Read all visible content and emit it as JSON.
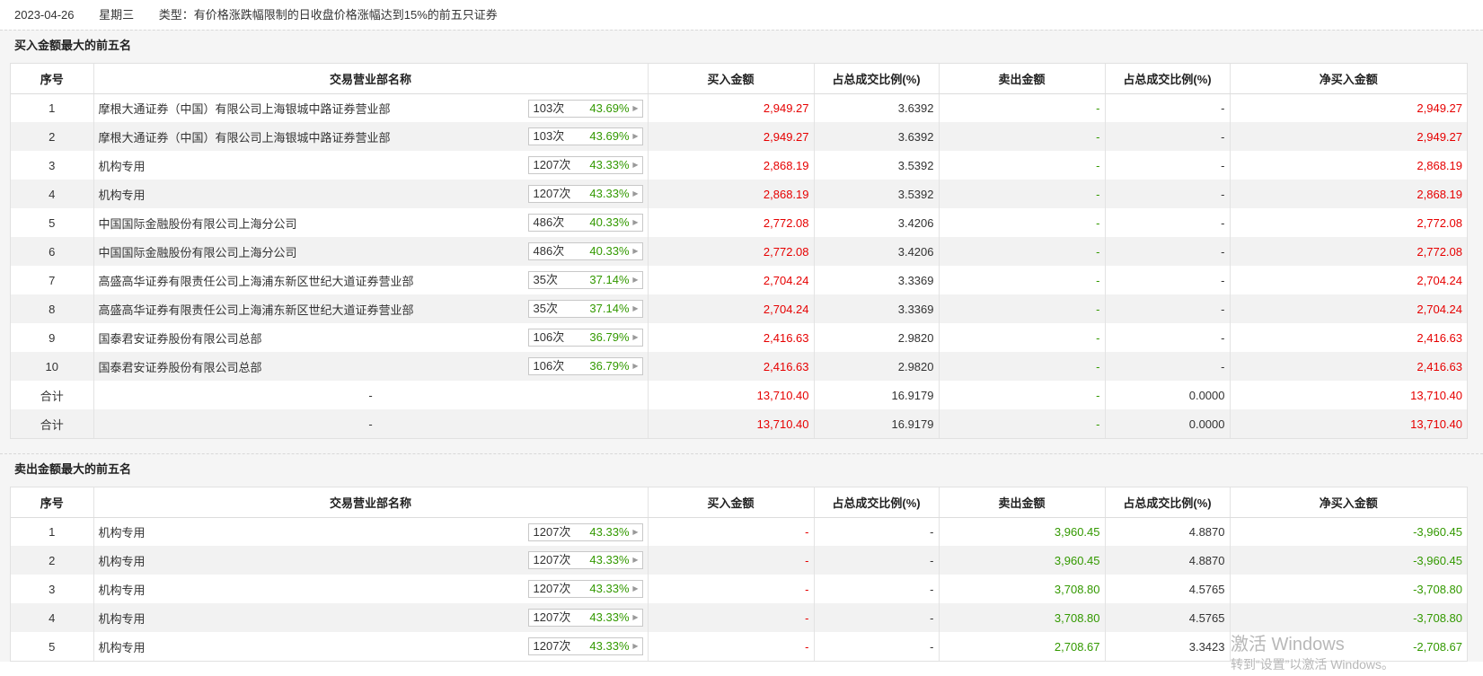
{
  "topline": {
    "date": "2023-04-26",
    "weekday": "星期三",
    "type": "类型：有价格涨跌幅限制的日收盘价格涨幅达到15%的前五只证券"
  },
  "buy_section": {
    "title": "买入金额最大的前五名",
    "headers": [
      "序号",
      "交易营业部名称",
      "买入金额",
      "占总成交比例(%)",
      "卖出金额",
      "占总成交比例(%)",
      "净买入金额"
    ],
    "rows": [
      {
        "no": "1",
        "name": "摩根大通证券（中国）有限公司上海银城中路证券营业部",
        "count": "103次",
        "pct": "43.69%",
        "buy": "2,949.27",
        "buy_ratio": "3.6392",
        "sell": "-",
        "sell_ratio": "-",
        "net": "2,949.27"
      },
      {
        "no": "2",
        "name": "摩根大通证券（中国）有限公司上海银城中路证券营业部",
        "count": "103次",
        "pct": "43.69%",
        "buy": "2,949.27",
        "buy_ratio": "3.6392",
        "sell": "-",
        "sell_ratio": "-",
        "net": "2,949.27"
      },
      {
        "no": "3",
        "name": "机构专用",
        "count": "1207次",
        "pct": "43.33%",
        "buy": "2,868.19",
        "buy_ratio": "3.5392",
        "sell": "-",
        "sell_ratio": "-",
        "net": "2,868.19"
      },
      {
        "no": "4",
        "name": "机构专用",
        "count": "1207次",
        "pct": "43.33%",
        "buy": "2,868.19",
        "buy_ratio": "3.5392",
        "sell": "-",
        "sell_ratio": "-",
        "net": "2,868.19"
      },
      {
        "no": "5",
        "name": "中国国际金融股份有限公司上海分公司",
        "count": "486次",
        "pct": "40.33%",
        "buy": "2,772.08",
        "buy_ratio": "3.4206",
        "sell": "-",
        "sell_ratio": "-",
        "net": "2,772.08"
      },
      {
        "no": "6",
        "name": "中国国际金融股份有限公司上海分公司",
        "count": "486次",
        "pct": "40.33%",
        "buy": "2,772.08",
        "buy_ratio": "3.4206",
        "sell": "-",
        "sell_ratio": "-",
        "net": "2,772.08"
      },
      {
        "no": "7",
        "name": "高盛高华证券有限责任公司上海浦东新区世纪大道证券营业部",
        "count": "35次",
        "pct": "37.14%",
        "buy": "2,704.24",
        "buy_ratio": "3.3369",
        "sell": "-",
        "sell_ratio": "-",
        "net": "2,704.24"
      },
      {
        "no": "8",
        "name": "高盛高华证券有限责任公司上海浦东新区世纪大道证券营业部",
        "count": "35次",
        "pct": "37.14%",
        "buy": "2,704.24",
        "buy_ratio": "3.3369",
        "sell": "-",
        "sell_ratio": "-",
        "net": "2,704.24"
      },
      {
        "no": "9",
        "name": "国泰君安证券股份有限公司总部",
        "count": "106次",
        "pct": "36.79%",
        "buy": "2,416.63",
        "buy_ratio": "2.9820",
        "sell": "-",
        "sell_ratio": "-",
        "net": "2,416.63"
      },
      {
        "no": "10",
        "name": "国泰君安证券股份有限公司总部",
        "count": "106次",
        "pct": "36.79%",
        "buy": "2,416.63",
        "buy_ratio": "2.9820",
        "sell": "-",
        "sell_ratio": "-",
        "net": "2,416.63"
      }
    ],
    "totals": [
      {
        "label": "合计",
        "name": "-",
        "buy": "13,710.40",
        "buy_ratio": "16.9179",
        "sell": "-",
        "sell_ratio": "0.0000",
        "net": "13,710.40"
      },
      {
        "label": "合计",
        "name": "-",
        "buy": "13,710.40",
        "buy_ratio": "16.9179",
        "sell": "-",
        "sell_ratio": "0.0000",
        "net": "13,710.40"
      }
    ]
  },
  "sell_section": {
    "title": "卖出金额最大的前五名",
    "headers": [
      "序号",
      "交易营业部名称",
      "买入金额",
      "占总成交比例(%)",
      "卖出金额",
      "占总成交比例(%)",
      "净买入金额"
    ],
    "rows": [
      {
        "no": "1",
        "name": "机构专用",
        "count": "1207次",
        "pct": "43.33%",
        "buy": "-",
        "buy_ratio": "-",
        "sell": "3,960.45",
        "sell_ratio": "4.8870",
        "net": "-3,960.45"
      },
      {
        "no": "2",
        "name": "机构专用",
        "count": "1207次",
        "pct": "43.33%",
        "buy": "-",
        "buy_ratio": "-",
        "sell": "3,960.45",
        "sell_ratio": "4.8870",
        "net": "-3,960.45"
      },
      {
        "no": "3",
        "name": "机构专用",
        "count": "1207次",
        "pct": "43.33%",
        "buy": "-",
        "buy_ratio": "-",
        "sell": "3,708.80",
        "sell_ratio": "4.5765",
        "net": "-3,708.80"
      },
      {
        "no": "4",
        "name": "机构专用",
        "count": "1207次",
        "pct": "43.33%",
        "buy": "-",
        "buy_ratio": "-",
        "sell": "3,708.80",
        "sell_ratio": "4.5765",
        "net": "-3,708.80"
      },
      {
        "no": "5",
        "name": "机构专用",
        "count": "1207次",
        "pct": "43.33%",
        "buy": "-",
        "buy_ratio": "-",
        "sell": "2,708.67",
        "sell_ratio": "3.3423",
        "net": "-2,708.67"
      }
    ]
  },
  "watermark": {
    "line1": "激活 Windows",
    "line2": "转到“设置”以激活 Windows。"
  },
  "colors": {
    "up": "#e60000",
    "down": "#339900",
    "stripe": "#f2f2f2"
  }
}
